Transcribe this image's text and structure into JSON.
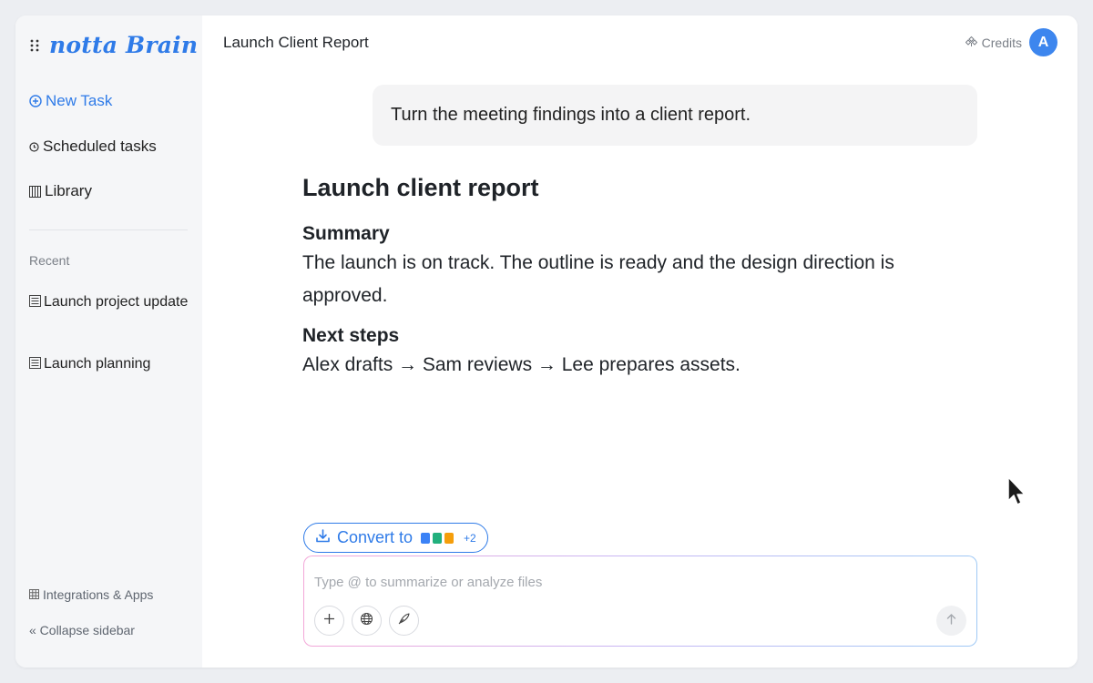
{
  "app": {
    "logo_text": "notta Brain",
    "brand_color": "#2f7be8"
  },
  "sidebar": {
    "new_task_label": "New Task",
    "scheduled_label": "Scheduled tasks",
    "library_label": "Library",
    "recent_label": "Recent",
    "recent_items": [
      {
        "label": "Launch project update"
      },
      {
        "label": "Launch planning"
      }
    ],
    "integrations_label": "Integrations & Apps",
    "collapse_label": "« Collapse sidebar"
  },
  "header": {
    "title": "Launch Client Report",
    "credits_label": "Credits",
    "avatar_initial": "A"
  },
  "conversation": {
    "user_message": "Turn the meeting findings into a client report.",
    "report": {
      "title": "Launch client report",
      "summary_heading": "Summary",
      "summary_text": "The launch is on track. The outline is ready and the design direction is approved.",
      "next_steps_heading": "Next steps",
      "next_steps_text": "Alex drafts → Sam reviews → Lee prepares assets."
    }
  },
  "convert": {
    "label": "Convert to",
    "extra_count": "+2",
    "icons": [
      "doc-icon",
      "image-icon",
      "slides-icon"
    ]
  },
  "composer": {
    "placeholder": "Type @ to summarize or analyze files",
    "value": ""
  }
}
